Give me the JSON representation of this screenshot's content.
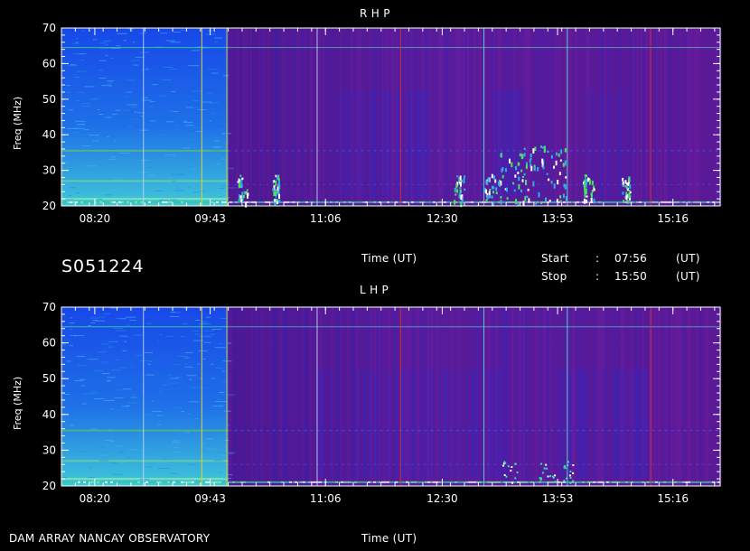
{
  "page": {
    "session_id": "S051224",
    "footer_left": "DAM ARRAY   NANCAY OBSERVATORY",
    "start_label": "Start",
    "start_sep": ":",
    "start_time": "07:56",
    "start_unit": "(UT)",
    "stop_label": "Stop",
    "stop_sep": ":",
    "stop_time": "15:50",
    "stop_unit": "(UT)"
  },
  "colors": {
    "background": "#000000",
    "axis": "#ffffff",
    "early_band": "#1f5fe6",
    "late_band": "#5a1a9a",
    "burst": "#36e090",
    "hot": "#ffffff",
    "marker_yellow": "#e0d040",
    "marker_red": "#e03030",
    "marker_cyan": "#60e0d0"
  },
  "chart_data": [
    {
      "type": "heatmap",
      "title": "R H P",
      "xlabel": "Time (UT)",
      "ylabel": "Freq (MHz)",
      "x_ticks": [
        "08:20",
        "09:43",
        "11:06",
        "12:30",
        "13:53",
        "15:16"
      ],
      "y_ticks": [
        20,
        30,
        40,
        50,
        60,
        70
      ],
      "xlim": [
        "07:56",
        "15:50"
      ],
      "ylim": [
        20,
        70
      ]
    },
    {
      "type": "heatmap",
      "title": "L H P",
      "xlabel": "Time (UT)",
      "ylabel": "Freq (MHz)",
      "x_ticks": [
        "08:20",
        "09:43",
        "11:06",
        "12:30",
        "13:53",
        "15:16"
      ],
      "y_ticks": [
        20,
        30,
        40,
        50,
        60,
        70
      ],
      "xlim": [
        "07:56",
        "15:50"
      ],
      "ylim": [
        20,
        70
      ]
    }
  ]
}
